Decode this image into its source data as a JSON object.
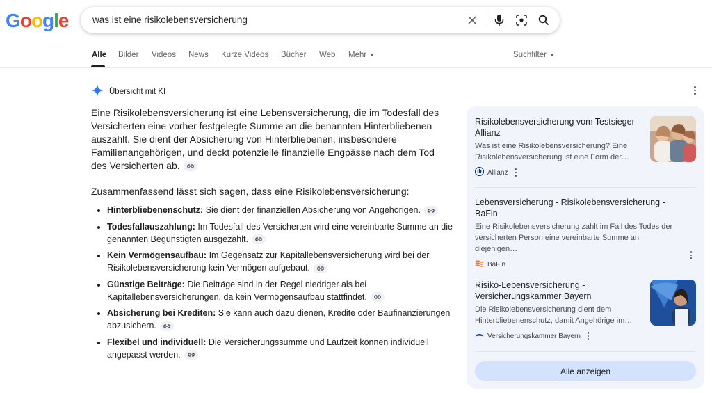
{
  "logo": {
    "letters": [
      "G",
      "o",
      "o",
      "g",
      "l",
      "e"
    ]
  },
  "search": {
    "query": "was ist eine risikolebensversicherung"
  },
  "tabs": [
    {
      "label": "Alle"
    },
    {
      "label": "Bilder"
    },
    {
      "label": "Videos"
    },
    {
      "label": "News"
    },
    {
      "label": "Kurze Videos"
    },
    {
      "label": "Bücher"
    },
    {
      "label": "Web"
    },
    {
      "label": "Mehr"
    }
  ],
  "tools": {
    "label": "Suchfilter"
  },
  "ai_overview": {
    "title": "Übersicht mit KI",
    "intro": "Eine Risikolebensversicherung ist eine Lebensversicherung, die im Todesfall des Versicherten eine vorher festgelegte Summe an die benannten Hinterbliebenen auszahlt. Sie dient der Absicherung von Hinterbliebenen, insbesondere Familienangehörigen, und deckt potenzielle finanzielle Engpässe nach dem Tod des Versicherten ab.",
    "summary": "Zusammenfassend lässt sich sagen, dass eine Risikolebensversicherung:",
    "items": [
      {
        "term": "Hinterbliebenenschutz:",
        "text": "Sie dient der finanziellen Absicherung von Angehörigen."
      },
      {
        "term": "Todesfallauszahlung:",
        "text": "Im Todesfall des Versicherten wird eine vereinbarte Summe an die genannten Begünstigten ausgezahlt."
      },
      {
        "term": "Kein Vermögensaufbau:",
        "text": "Im Gegensatz zur Kapitallebensversicherung wird bei der Risikolebensversicherung kein Vermögen aufgebaut."
      },
      {
        "term": "Günstige Beiträge:",
        "text": "Die Beiträge sind in der Regel niedriger als bei Kapitallebensversicherungen, da kein Vermögensaufbau stattfindet."
      },
      {
        "term": "Absicherung bei Krediten:",
        "text": "Sie kann auch dazu dienen, Kredite oder Baufinanzierungen abzusichern."
      },
      {
        "term": "Flexibel und individuell:",
        "text": "Die Versicherungssumme und Laufzeit können individuell angepasst werden."
      }
    ]
  },
  "sources": [
    {
      "title": "Risikolebensversicherung vom Testsieger - Allianz",
      "snippet": "Was ist eine Risikolebensversicherung? Eine Risikolebensversicherung ist eine Form der…",
      "source": "Allianz"
    },
    {
      "title": "Lebensversicherung - Risikolebensversicherung - BaFin",
      "snippet": "Eine Risikolebensversicherung zahlt im Fall des Todes der versicherten Person eine vereinbarte Summe an diejenigen…",
      "source": "BaFin"
    },
    {
      "title": "Risiko-Lebensversicherung - Versicherungskammer Bayern",
      "snippet": "Die Risikolebensversicherung dient dem Hinterbliebenenschutz, damit Angehörige im…",
      "source": "Versicherungskammer Bayern"
    }
  ],
  "show_all": "Alle anzeigen",
  "colors": {
    "accent": "#1a73e8",
    "panel": "#f1f4fb",
    "button": "#d3e3fd"
  }
}
